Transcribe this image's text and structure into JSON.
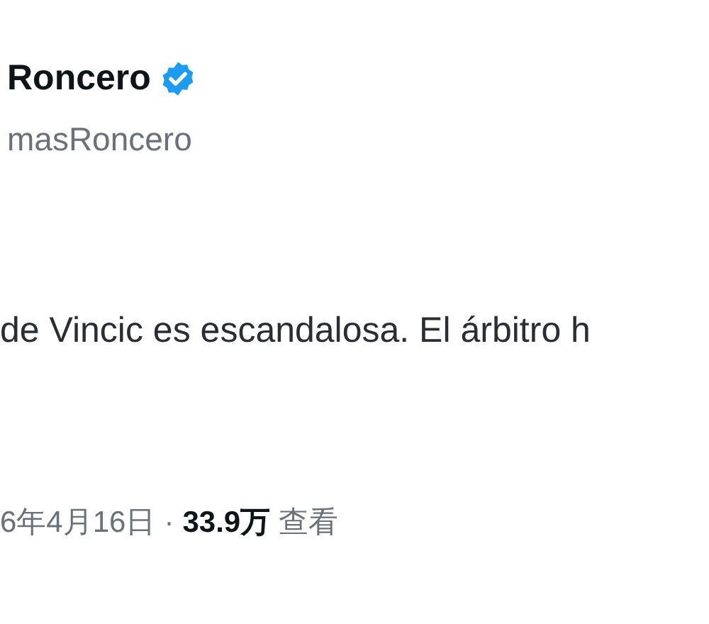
{
  "author": {
    "name": "Roncero",
    "verified": true,
    "handle": "masRoncero"
  },
  "tweet": {
    "text": "de Vincic es escandalosa. El árbitro h"
  },
  "meta": {
    "date": "6年4月16日",
    "separator": "·",
    "views": "33.9万",
    "views_label": "查看"
  }
}
